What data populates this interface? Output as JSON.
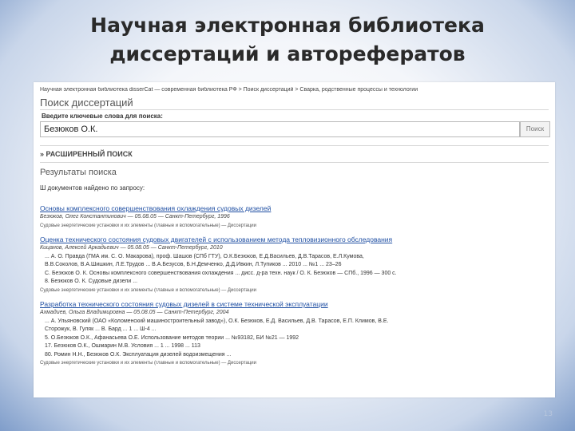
{
  "slide": {
    "title_line1": "Научная электронная библиотека",
    "title_line2": "диссертаций и авторефератов",
    "page_number": "13"
  },
  "site": {
    "breadcrumb": "Научная электронная библиотека disserCat — современная библиотека РФ > Поиск диссертаций > Сварка, родственные процессы и технологии",
    "search_title": "Поиск диссертаций",
    "keywords_label": "Введите ключевые слова для поиска:",
    "search_value": "Безюков О.К.",
    "search_button": "Поиск",
    "advanced_label": "РАСШИРЕННЫЙ ПОИСК",
    "results_title": "Результаты поиска",
    "found_text": "Ш документов найдено по запросу:"
  },
  "results": [
    {
      "title": "Основы комплексного совершенствования охлаждения судовых дизелей",
      "meta": "Безюков, Олег Константинович — 05.08.05 — Санкт-Петербург, 1996",
      "lines": [],
      "category": "Судовые энергетические установки и их элементы (главные и вспомогательные) — Диссертации"
    },
    {
      "title": "Оценка технического состояния судовых двигателей с использованием метода тепловизионного обследования",
      "meta": "Кицанов, Алексей Аркадьевич — 05.08.05 — Санкт-Петербург, 2010",
      "lines": [
        "... А. О. Правда (ГМА им. С. О. Макарова), проф. Шашов (СПб ГТУ), О.К.Безюков, Е.Д.Васильев, Д.В.Тарасов, Е.Л.Кумова,",
        "В.В.Соколов, В.А.Шишкин, Л.Е.Трудов ... В.А.Безусов, Б.Н.Демченко, Д.Д.Ивкин, Л.Тупиков ... 2010 ... №1 ... 23–26",
        "С. Безюков О. К. Основы комплексного совершенствования охлаждения ... дисс. д-ра техн. наук / О. К. Безюков — СПб., 1996 — 300 с.",
        "8. Безюков О. К. Судовые дизели ..."
      ],
      "category": "Судовые энергетические установки и их элементы (главные и вспомогательные) — Диссертации"
    },
    {
      "title": "Разработка технического состояния судовых дизелей в системе технической эксплуатации",
      "meta": "Ахмадиев, Ольга Владимировна — 05.08.05 — Санкт-Петербург, 2004",
      "lines": [
        "... А. Ульяновский (ОАО «Коломенский машиностроительный завод»), О.К. Безюков, Е.Д. Васильев, Д.В. Тарасов, Е.П. Климов, В.Е.",
        "Сторожук, В. Гуляк ... В. Бард ... 1 ... Ш-4 ...",
        "5. О.Безюков О.К., Афанасьева О.Е. Использование методов теории ... №93182, БИ №21 — 1992",
        "17. Безюков О.К., Ошмарин М.В. Условия ... 1 ... 1998 ... 113",
        "80. Ромин Н.Н., Безюков О.К. Эксплуатация дизелей водоизмещения ..."
      ],
      "category": "Судовые энергетические установки и их элементы (главные и вспомогательные) — Диссертации"
    }
  ]
}
